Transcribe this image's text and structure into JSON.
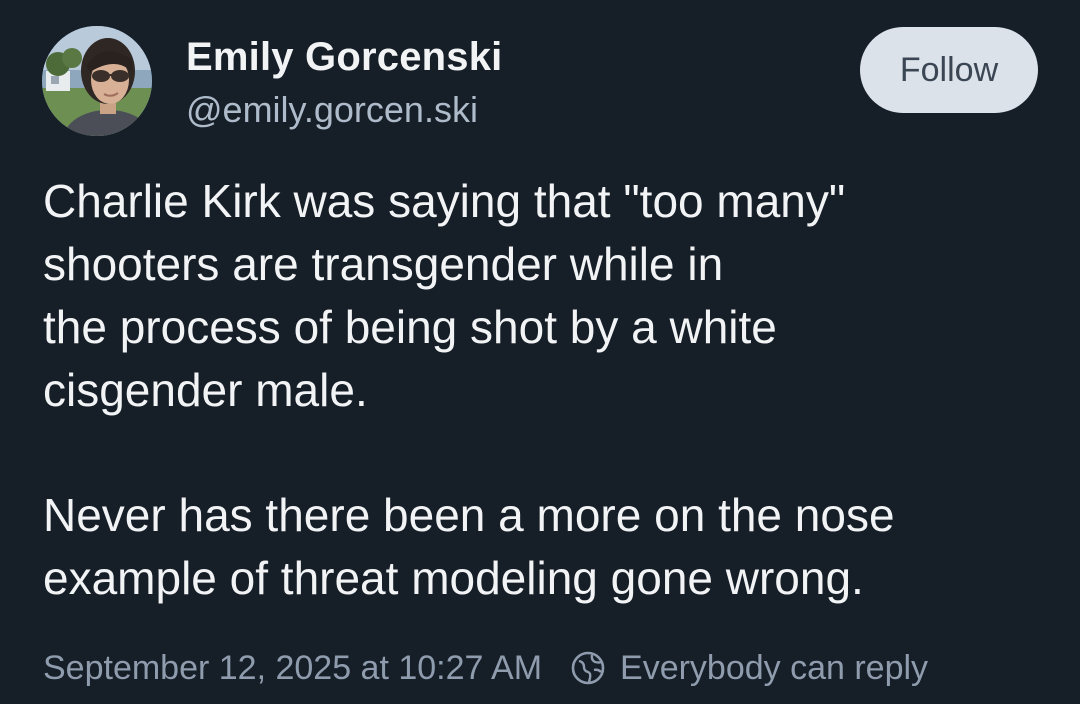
{
  "author": {
    "display_name": "Emily Gorcenski",
    "handle": "@emily.gorcen.ski",
    "avatar_icon": "profile-photo"
  },
  "actions": {
    "follow_label": "Follow"
  },
  "post": {
    "lines": [
      "Charlie Kirk was saying that \"too many\"",
      "shooters are transgender while in",
      "the process of being shot by a white",
      "cisgender male.",
      "Never has there been a more on the nose",
      "example of threat modeling gone wrong."
    ]
  },
  "meta": {
    "timestamp": "September 12, 2025 at 10:27 AM",
    "reply_setting": "Everybody can reply",
    "reply_icon": "globe-icon"
  },
  "colors": {
    "background": "#161e27",
    "primary_text": "#f1f3f5",
    "secondary_text": "#aebbca",
    "meta_text": "#8f9cae",
    "follow_button_bg": "#dce2ea",
    "follow_button_text": "#3b4654"
  }
}
